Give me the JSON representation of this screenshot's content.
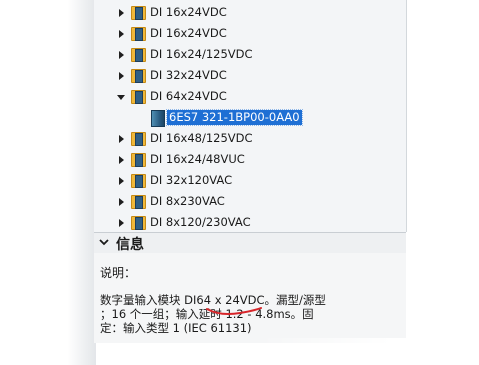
{
  "tree": {
    "items": [
      {
        "label": "DI 16x24VDC",
        "state": "collapsed",
        "kind": "folder"
      },
      {
        "label": "DI 16x24VDC",
        "state": "collapsed",
        "kind": "folder"
      },
      {
        "label": "DI 16x24/125VDC",
        "state": "collapsed",
        "kind": "folder"
      },
      {
        "label": "DI 32x24VDC",
        "state": "collapsed",
        "kind": "folder"
      },
      {
        "label": "DI 64x24VDC",
        "state": "expanded",
        "kind": "folder"
      },
      {
        "label": "6ES7 321-1BP00-0AA0",
        "state": "selected",
        "kind": "module"
      },
      {
        "label": "DI 16x48/125VDC",
        "state": "collapsed",
        "kind": "folder"
      },
      {
        "label": "DI 16x24/48VUC",
        "state": "collapsed",
        "kind": "folder"
      },
      {
        "label": "DI 32x120VAC",
        "state": "collapsed",
        "kind": "folder"
      },
      {
        "label": "DI 8x230VAC",
        "state": "collapsed",
        "kind": "folder"
      },
      {
        "label": "DI 8x120/230VAC",
        "state": "collapsed",
        "kind": "folder"
      }
    ]
  },
  "info": {
    "title": "信息",
    "description_label": "说明：",
    "description_lines": [
      "数字量输入模块 DI64 x 24VDC。漏型/源型",
      "；16 个一组；输入延时 1.2 - 4.8ms。固",
      "定：输入类型 1 (IEC 61131)"
    ]
  },
  "colors": {
    "selection": "#1e6fd4",
    "panel_bg": "#f3f5f7",
    "annotation_red": "#d8262b"
  },
  "icons": {
    "collapse": "chevron-down-icon",
    "folder": "folder-card-icon",
    "module": "module-icon"
  }
}
